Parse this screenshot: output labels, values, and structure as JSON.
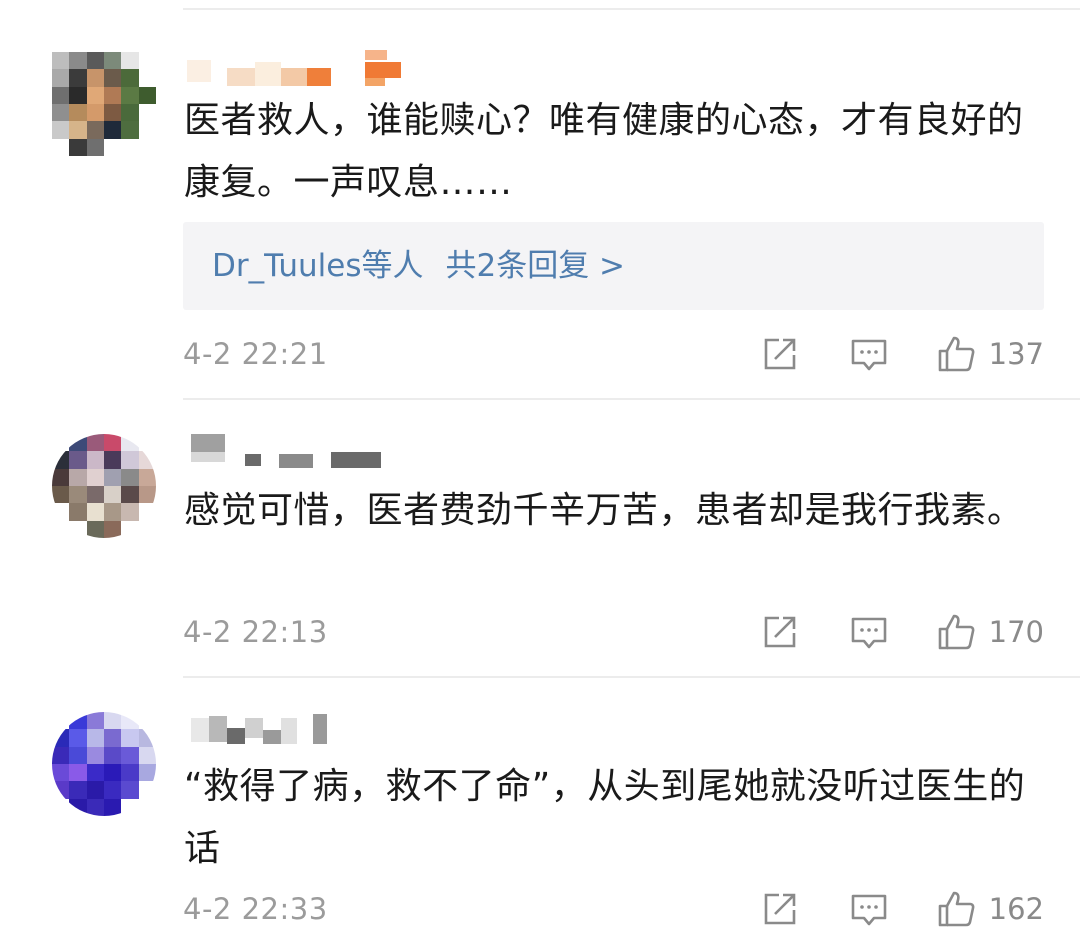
{
  "comments": [
    {
      "username": "",
      "text": "医者救人，谁能赎心？唯有健康的心态，才有良好的康复。一声叹息……",
      "reply": {
        "who": "Dr_Tuules等人",
        "count": "共2条回复 >"
      },
      "time": "4-2 22:21",
      "likes": "137"
    },
    {
      "username": "",
      "text": "感觉可惜，医者费劲千辛万苦，患者却是我行我素。",
      "time": "4-2 22:13",
      "likes": "170"
    },
    {
      "username": "",
      "text": "“救得了病，救不了命”，从头到尾她就没听过医生的话",
      "time": "4-2 22:33",
      "likes": "162"
    }
  ],
  "icons": {
    "share": "share-icon",
    "reply": "comment-icon",
    "like": "thumbs-up-icon"
  },
  "colors": {
    "reply_link": "#4f7dae",
    "meta_text": "#9b9b9b",
    "icon_stroke": "#8a8a8a",
    "divider": "#ececec",
    "reply_bg": "#f4f4f6"
  }
}
